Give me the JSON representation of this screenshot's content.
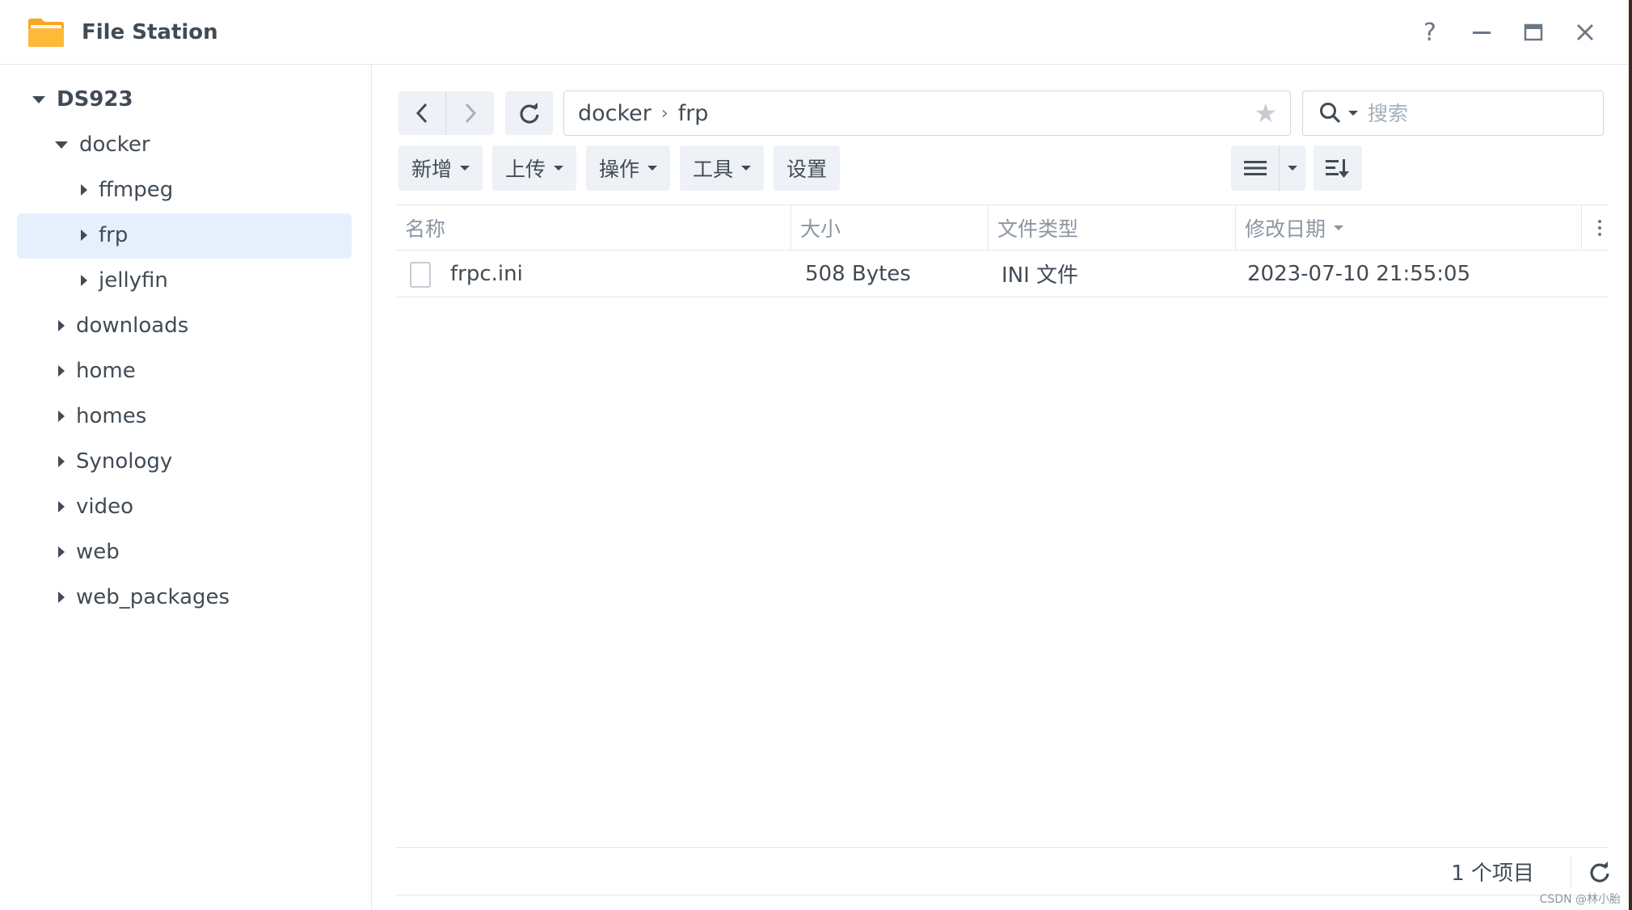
{
  "window": {
    "title": "File Station",
    "help_label": "?"
  },
  "sidebar": {
    "root": "DS923",
    "items": [
      {
        "label": "docker",
        "level": 1,
        "expanded": true
      },
      {
        "label": "ffmpeg",
        "level": 2,
        "expanded": false
      },
      {
        "label": "frp",
        "level": 2,
        "expanded": false,
        "selected": true
      },
      {
        "label": "jellyfin",
        "level": 2,
        "expanded": false
      },
      {
        "label": "downloads",
        "level": 1,
        "expanded": false
      },
      {
        "label": "home",
        "level": 1,
        "expanded": false
      },
      {
        "label": "homes",
        "level": 1,
        "expanded": false
      },
      {
        "label": "Synology",
        "level": 1,
        "expanded": false
      },
      {
        "label": "video",
        "level": 1,
        "expanded": false
      },
      {
        "label": "web",
        "level": 1,
        "expanded": false
      },
      {
        "label": "web_packages",
        "level": 1,
        "expanded": false
      }
    ]
  },
  "path": {
    "segments": [
      "docker",
      "frp"
    ],
    "separator": "›"
  },
  "search": {
    "placeholder": "搜索"
  },
  "toolbar": {
    "create_label": "新增",
    "upload_label": "上传",
    "action_label": "操作",
    "tools_label": "工具",
    "settings_label": "设置"
  },
  "table": {
    "columns": [
      "名称",
      "大小",
      "文件类型",
      "修改日期"
    ],
    "rows": [
      {
        "name": "frpc.ini",
        "size": "508 Bytes",
        "type": "INI 文件",
        "modified": "2023-07-10 21:55:05"
      }
    ]
  },
  "footer": {
    "count": "1 个项目"
  },
  "watermark": "CSDN @林小胎",
  "colors": {
    "selected_bg": "#e6f0fd",
    "button_bg": "#eef1f5",
    "text": "#414b55",
    "muted": "#8b96a3"
  }
}
